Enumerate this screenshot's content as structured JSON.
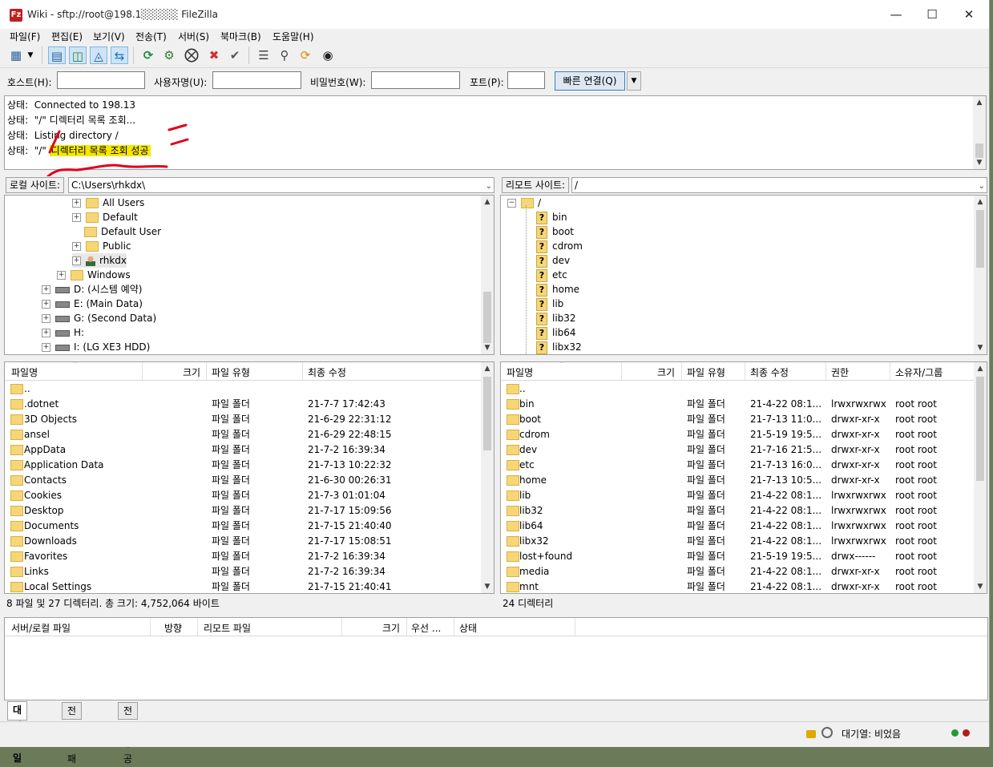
{
  "window": {
    "title": "Wiki - sftp://root@198.1░░░░░ FileZilla",
    "app_icon": "Fz",
    "controls": {
      "minimize": "—",
      "maximize": "☐",
      "close": "✕"
    }
  },
  "menu": [
    "파일(F)",
    "편집(E)",
    "보기(V)",
    "전송(T)",
    "서버(S)",
    "북마크(B)",
    "도움말(H)"
  ],
  "toolbar_icons": [
    "site-manager-icon",
    "dropdown-arrow-icon",
    "toggle-log-icon",
    "toggle-local-tree-icon",
    "toggle-remote-tree-icon",
    "toggle-queue-icon",
    "refresh-icon",
    "process-queue-icon",
    "cancel-icon",
    "disconnect-icon",
    "reconnect-icon",
    "filter-icon",
    "compare-icon",
    "sync-browse-icon",
    "search-icon"
  ],
  "quickconnect": {
    "host_label": "호스트(H):",
    "user_label": "사용자명(U):",
    "pass_label": "비밀번호(W):",
    "port_label": "포트(P):",
    "button": "빠른 연결(Q)",
    "dropdown": "▼"
  },
  "log": [
    {
      "prefix": "상태:",
      "text": "Connected to 198.13",
      "highlight": ""
    },
    {
      "prefix": "상태:",
      "text": "\"/\" 디렉터리 목록 조회...",
      "highlight": ""
    },
    {
      "prefix": "상태:",
      "text": "Listing directory /",
      "highlight": ""
    },
    {
      "prefix": "상태:",
      "text": "\"/\" ",
      "highlight": "디렉터리 목록 조회 성공"
    }
  ],
  "local": {
    "label": "로컬 사이트:",
    "path": "C:\\Users\\rhkdx\\",
    "tree": [
      {
        "text": "All Users",
        "type": "folder"
      },
      {
        "text": "Default",
        "type": "folder"
      },
      {
        "text": "Default User",
        "type": "folder"
      },
      {
        "text": "Public",
        "type": "folder"
      },
      {
        "text": "rhkdx",
        "type": "user"
      },
      {
        "text": "Windows",
        "type": "folder"
      },
      {
        "text": "D: (시스템 예약)",
        "type": "drive"
      },
      {
        "text": "E: (Main Data)",
        "type": "drive"
      },
      {
        "text": "G: (Second Data)",
        "type": "drive"
      },
      {
        "text": "H:",
        "type": "drive"
      },
      {
        "text": "I: (LG XE3 HDD)",
        "type": "drive"
      }
    ],
    "columns": [
      "파일명",
      "크기",
      "파일 유형",
      "최종 수정"
    ],
    "files": [
      {
        "name": "..",
        "type": "",
        "modified": ""
      },
      {
        "name": ".dotnet",
        "type": "파일 폴더",
        "modified": "21-7-7 17:42:43"
      },
      {
        "name": "3D Objects",
        "type": "파일 폴더",
        "modified": "21-6-29 22:31:12"
      },
      {
        "name": "ansel",
        "type": "파일 폴더",
        "modified": "21-6-29 22:48:15"
      },
      {
        "name": "AppData",
        "type": "파일 폴더",
        "modified": "21-7-2 16:39:34"
      },
      {
        "name": "Application Data",
        "type": "파일 폴더",
        "modified": "21-7-13 10:22:32"
      },
      {
        "name": "Contacts",
        "type": "파일 폴더",
        "modified": "21-6-30 00:26:31"
      },
      {
        "name": "Cookies",
        "type": "파일 폴더",
        "modified": "21-7-3 01:01:04"
      },
      {
        "name": "Desktop",
        "type": "파일 폴더",
        "modified": "21-7-17 15:09:56"
      },
      {
        "name": "Documents",
        "type": "파일 폴더",
        "modified": "21-7-15 21:40:40"
      },
      {
        "name": "Downloads",
        "type": "파일 폴더",
        "modified": "21-7-17 15:08:51"
      },
      {
        "name": "Favorites",
        "type": "파일 폴더",
        "modified": "21-7-2 16:39:34"
      },
      {
        "name": "Links",
        "type": "파일 폴더",
        "modified": "21-7-2 16:39:34"
      },
      {
        "name": "Local Settings",
        "type": "파일 폴더",
        "modified": "21-7-15 21:40:41"
      }
    ],
    "status": "8 파일 및 27 디렉터리. 총 크기: 4,752,064 바이트"
  },
  "remote": {
    "label": "리모트 사이트:",
    "path": "/",
    "tree_root": "/",
    "tree": [
      "bin",
      "boot",
      "cdrom",
      "dev",
      "etc",
      "home",
      "lib",
      "lib32",
      "lib64",
      "libx32"
    ],
    "columns": [
      "파일명",
      "크기",
      "파일 유형",
      "최종 수정",
      "권한",
      "소유자/그룹"
    ],
    "files": [
      {
        "name": "..",
        "type": "",
        "modified": "",
        "perm": "",
        "owner": ""
      },
      {
        "name": "bin",
        "type": "파일 폴더",
        "modified": "21-4-22 08:1...",
        "perm": "lrwxrwxrwx",
        "owner": "root root"
      },
      {
        "name": "boot",
        "type": "파일 폴더",
        "modified": "21-7-13 11:0...",
        "perm": "drwxr-xr-x",
        "owner": "root root"
      },
      {
        "name": "cdrom",
        "type": "파일 폴더",
        "modified": "21-5-19 19:5...",
        "perm": "drwxr-xr-x",
        "owner": "root root"
      },
      {
        "name": "dev",
        "type": "파일 폴더",
        "modified": "21-7-16 21:5...",
        "perm": "drwxr-xr-x",
        "owner": "root root"
      },
      {
        "name": "etc",
        "type": "파일 폴더",
        "modified": "21-7-13 16:0...",
        "perm": "drwxr-xr-x",
        "owner": "root root"
      },
      {
        "name": "home",
        "type": "파일 폴더",
        "modified": "21-7-13 10:5...",
        "perm": "drwxr-xr-x",
        "owner": "root root"
      },
      {
        "name": "lib",
        "type": "파일 폴더",
        "modified": "21-4-22 08:1...",
        "perm": "lrwxrwxrwx",
        "owner": "root root"
      },
      {
        "name": "lib32",
        "type": "파일 폴더",
        "modified": "21-4-22 08:1...",
        "perm": "lrwxrwxrwx",
        "owner": "root root"
      },
      {
        "name": "lib64",
        "type": "파일 폴더",
        "modified": "21-4-22 08:1...",
        "perm": "lrwxrwxrwx",
        "owner": "root root"
      },
      {
        "name": "libx32",
        "type": "파일 폴더",
        "modified": "21-4-22 08:1...",
        "perm": "lrwxrwxrwx",
        "owner": "root root"
      },
      {
        "name": "lost+found",
        "type": "파일 폴더",
        "modified": "21-5-19 19:5...",
        "perm": "drwx------",
        "owner": "root root"
      },
      {
        "name": "media",
        "type": "파일 폴더",
        "modified": "21-4-22 08:1...",
        "perm": "drwxr-xr-x",
        "owner": "root root"
      },
      {
        "name": "mnt",
        "type": "파일 폴더",
        "modified": "21-4-22 08:1...",
        "perm": "drwxr-xr-x",
        "owner": "root root"
      }
    ],
    "status": "24 디렉터리"
  },
  "queue": {
    "columns": [
      "서버/로컬 파일",
      "방향",
      "리모트 파일",
      "크기",
      "우선 ...",
      "상태"
    ],
    "tabs": [
      "대기 파일",
      "전송 실패",
      "전송 성공"
    ]
  },
  "statusbar": {
    "queue_text": "대기열: 비었음",
    "icons": [
      "lock-icon",
      "speed-limit-icon",
      "transfer-led-green",
      "transfer-led-red"
    ]
  },
  "colors": {
    "highlight": "#f6e600",
    "annotation": "#e0001c",
    "folder": "#f7d675",
    "accent_button": "#3c7fb1"
  }
}
